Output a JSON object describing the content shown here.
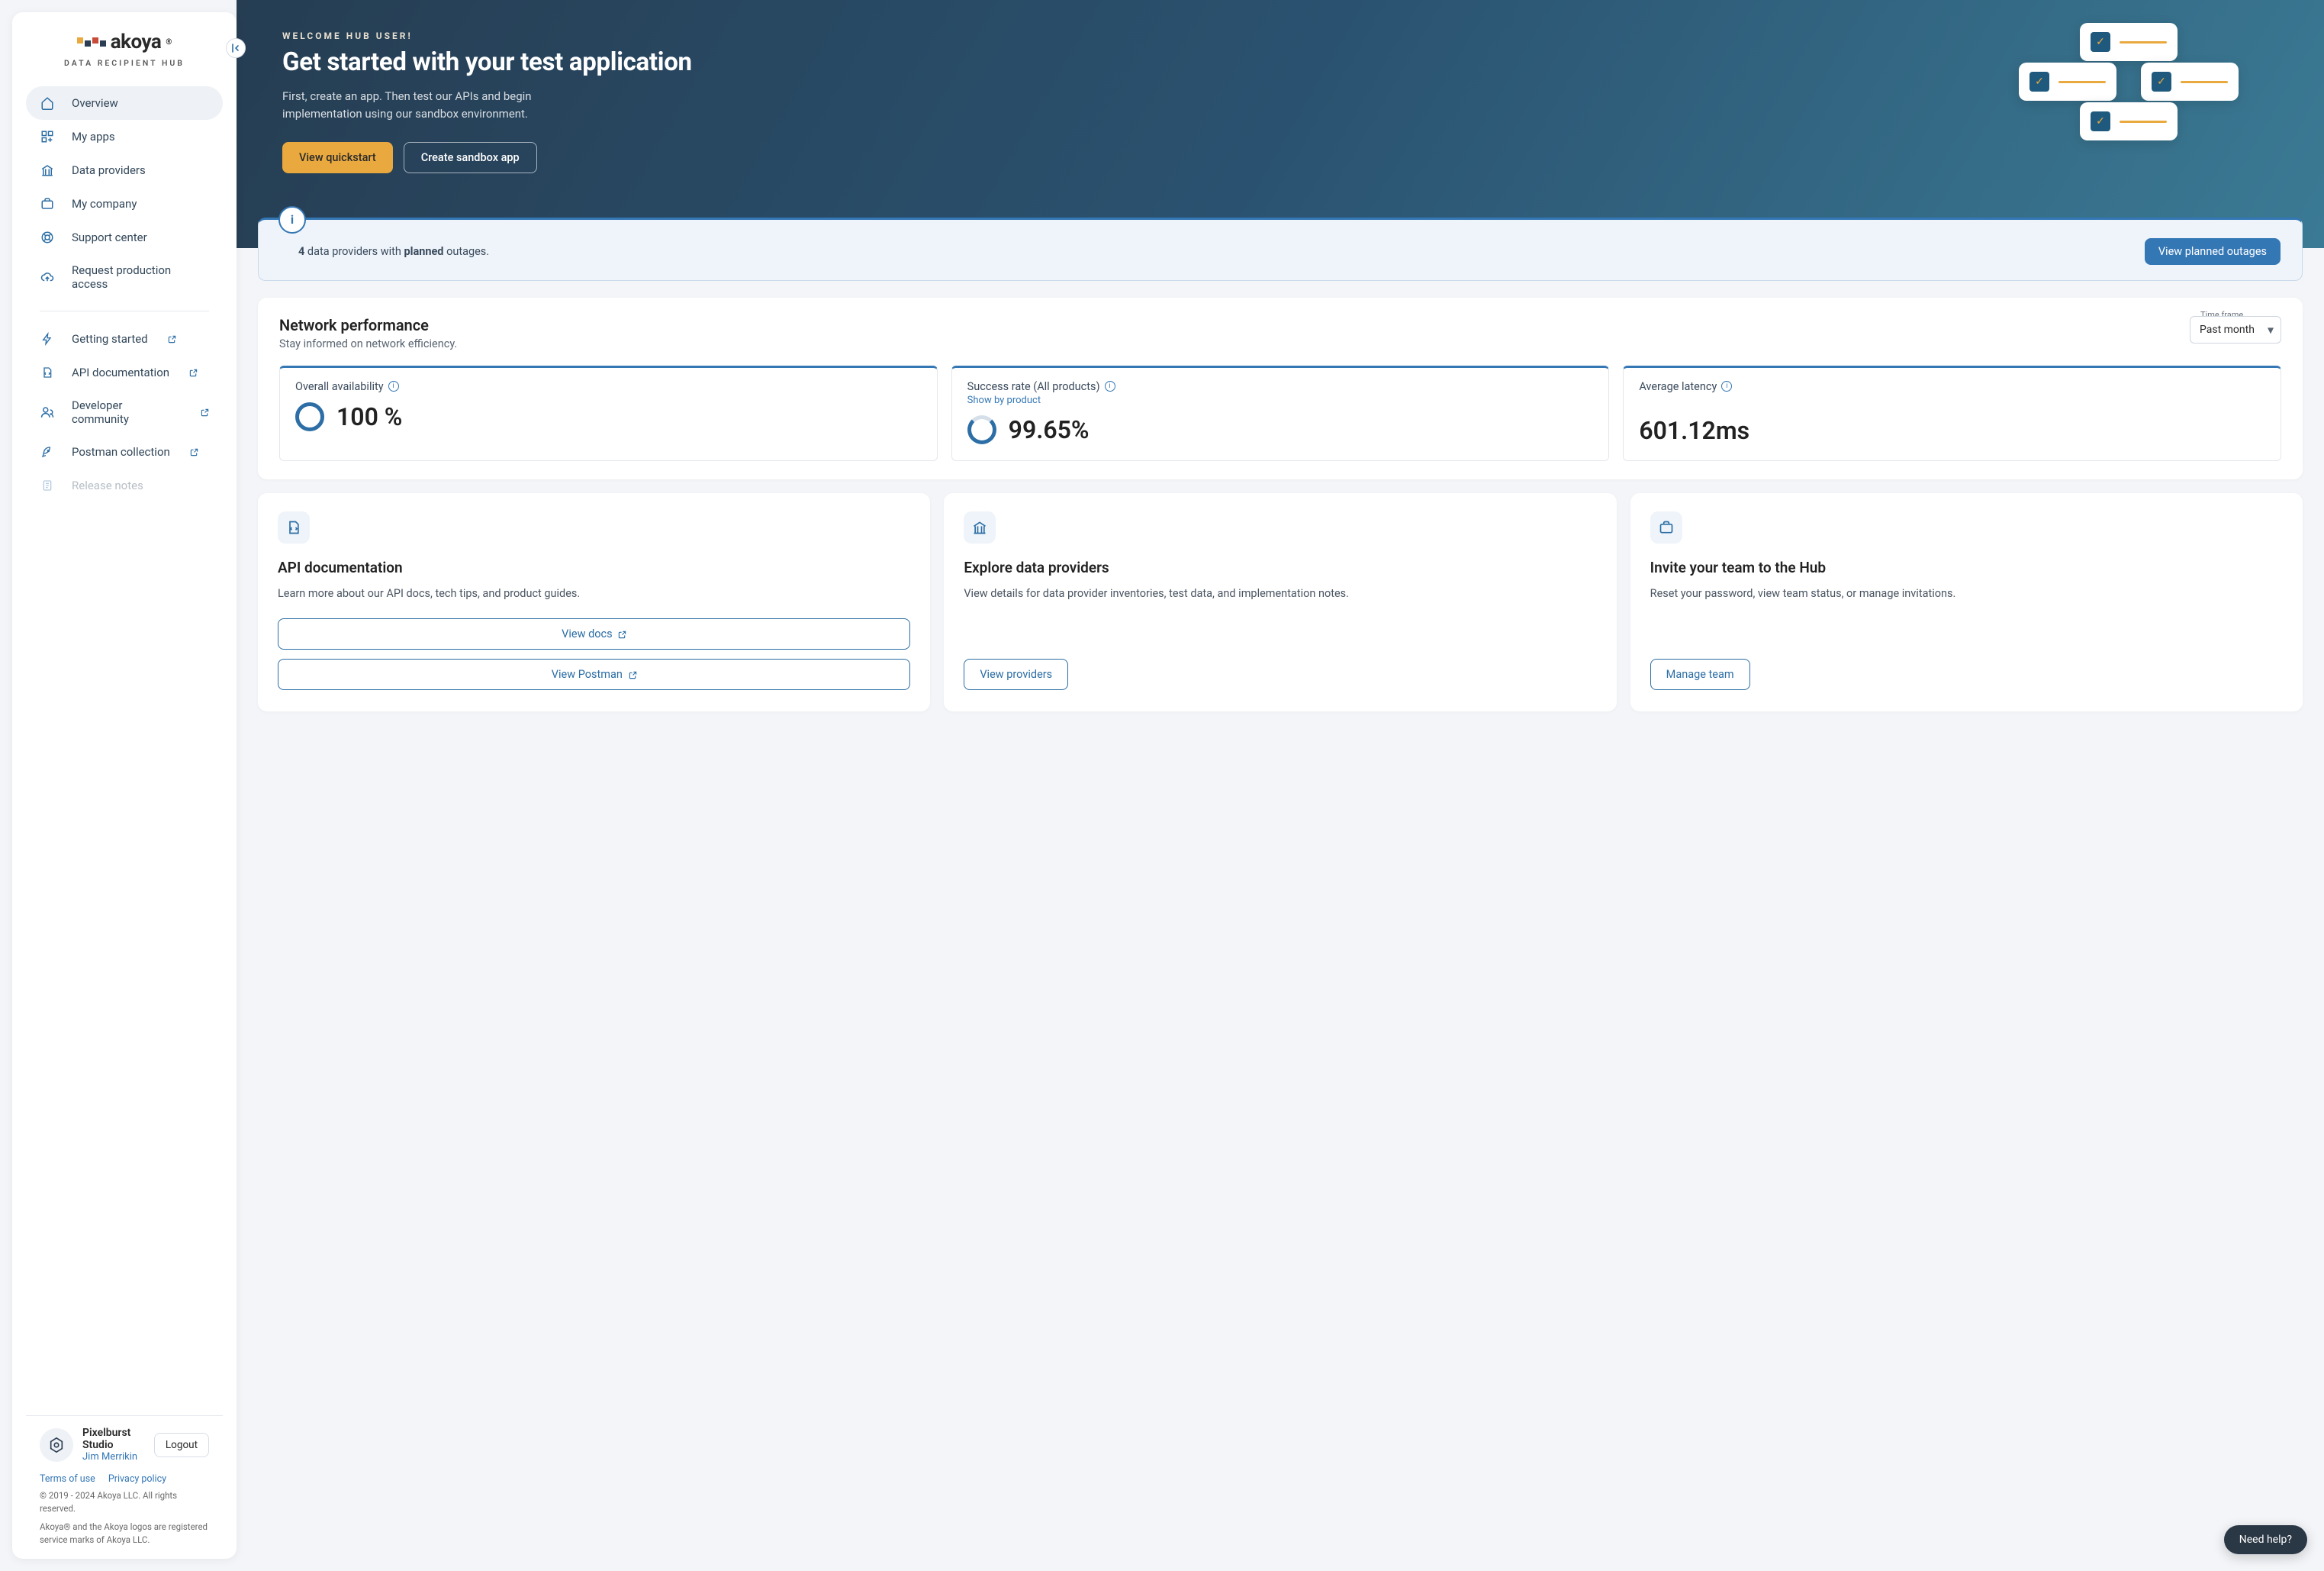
{
  "logo": {
    "brand": "akoya",
    "subtitle": "DATA RECIPIENT HUB"
  },
  "nav": {
    "primary": [
      {
        "label": "Overview"
      },
      {
        "label": "My apps"
      },
      {
        "label": "Data providers"
      },
      {
        "label": "My company"
      },
      {
        "label": "Support center"
      },
      {
        "label": "Request production access"
      }
    ],
    "secondary": [
      {
        "label": "Getting started"
      },
      {
        "label": "API documentation"
      },
      {
        "label": "Developer community"
      },
      {
        "label": "Postman collection"
      },
      {
        "label": "Release notes"
      }
    ]
  },
  "user": {
    "company": "Pixelburst Studio",
    "name": "Jim Merrikin",
    "logout": "Logout"
  },
  "footer": {
    "terms": "Terms of use",
    "privacy": "Privacy policy",
    "copyright": "© 2019 - 2024 Akoya LLC. All rights reserved.",
    "trademark": "Akoya® and the Akoya logos are registered service marks of Akoya LLC."
  },
  "hero": {
    "welcome": "WELCOME HUB USER!",
    "title": "Get started with your test application",
    "body": "First, create an app. Then test our APIs and begin implementation using our sandbox environment.",
    "btn_quickstart": "View quickstart",
    "btn_sandbox": "Create sandbox app"
  },
  "banner": {
    "count": "4",
    "text1": " data providers with ",
    "bold": "planned",
    "text2": " outages.",
    "btn": "View planned outages"
  },
  "network": {
    "title": "Network performance",
    "subtitle": "Stay informed on network efficiency.",
    "timeframe_label": "Time frame",
    "timeframe_value": "Past month",
    "metrics": [
      {
        "label": "Overall availability",
        "value": "100 %",
        "link": ""
      },
      {
        "label": "Success rate (All products)",
        "value": "99.65%",
        "link": "Show by product"
      },
      {
        "label": "Average latency",
        "value": "601.12ms",
        "link": ""
      }
    ]
  },
  "cards": [
    {
      "title": "API documentation",
      "desc": "Learn more about our API docs, tech tips, and product guides.",
      "btns": [
        "View docs",
        "View Postman"
      ]
    },
    {
      "title": "Explore data providers",
      "desc": "View details for data provider inventories, test data, and implementation notes.",
      "btns": [
        "View providers"
      ]
    },
    {
      "title": "Invite your team to the Hub",
      "desc": "Reset your password, view team status, or manage invitations.",
      "btns": [
        "Manage team"
      ]
    }
  ],
  "help": "Need help?"
}
